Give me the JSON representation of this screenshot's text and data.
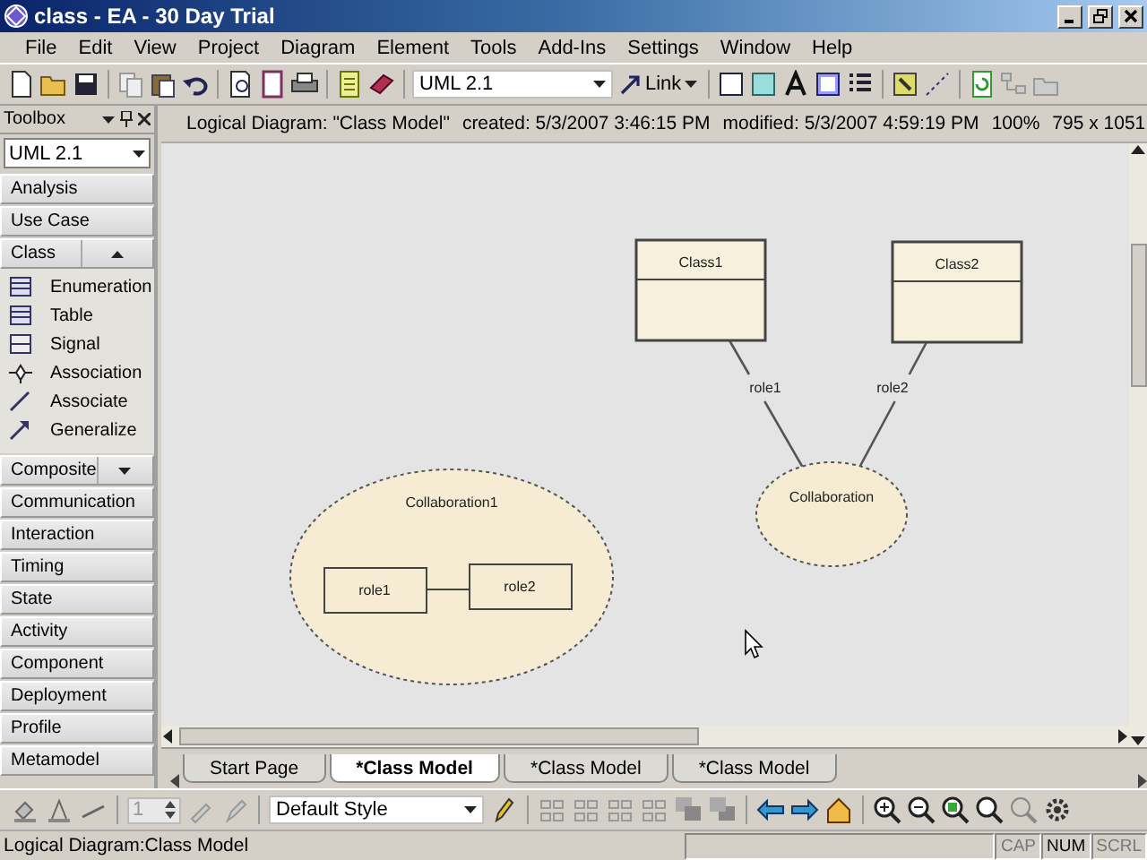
{
  "window": {
    "title": "class - EA - 30 Day Trial"
  },
  "menu": [
    "File",
    "Edit",
    "View",
    "Project",
    "Diagram",
    "Element",
    "Tools",
    "Add-Ins",
    "Settings",
    "Window",
    "Help"
  ],
  "toolbar": {
    "profile": "UML 2.1",
    "link": "Link"
  },
  "diagram_header": {
    "name": "Logical Diagram: \"Class Model\"",
    "created": "created: 5/3/2007 3:46:15 PM",
    "modified": "modified: 5/3/2007 4:59:19 PM",
    "zoom": "100%",
    "size": "795 x 1051"
  },
  "toolbox": {
    "title": "Toolbox",
    "profile": "UML 2.1",
    "groups": [
      {
        "label": "Analysis",
        "expanded": false
      },
      {
        "label": "Use Case",
        "expanded": false
      },
      {
        "label": "Class",
        "expanded": true,
        "items": [
          {
            "label": "Enumeration",
            "kind": "grid"
          },
          {
            "label": "Table",
            "kind": "grid"
          },
          {
            "label": "Signal",
            "kind": "signal"
          },
          {
            "label": "Association",
            "kind": "diamond"
          },
          {
            "label": "Associate",
            "kind": "line"
          },
          {
            "label": "Generalize",
            "kind": "arrow"
          }
        ]
      },
      {
        "label": "Composite",
        "expanded": false
      },
      {
        "label": "Communication",
        "expanded": false
      },
      {
        "label": "Interaction",
        "expanded": false
      },
      {
        "label": "Timing",
        "expanded": false
      },
      {
        "label": "State",
        "expanded": false
      },
      {
        "label": "Activity",
        "expanded": false
      },
      {
        "label": "Component",
        "expanded": false
      },
      {
        "label": "Deployment",
        "expanded": false
      },
      {
        "label": "Profile",
        "expanded": false
      },
      {
        "label": "Metamodel",
        "expanded": false
      }
    ]
  },
  "diagram": {
    "classes": [
      {
        "name": "Class1"
      },
      {
        "name": "Class2"
      }
    ],
    "links": [
      {
        "label": "role1"
      },
      {
        "label": "role2"
      }
    ],
    "collaboration": {
      "name": "Collaboration"
    },
    "composite": {
      "name": "Collaboration1",
      "parts": [
        "role1",
        "role2"
      ]
    }
  },
  "tabs": [
    {
      "label": "Start Page",
      "selected": false
    },
    {
      "label": "*Class Model",
      "selected": true
    },
    {
      "label": "*Class Model",
      "selected": false
    },
    {
      "label": "*Class Model",
      "selected": false
    }
  ],
  "bottom_toolbar": {
    "spinner": "1",
    "style": "Default Style"
  },
  "status_bar": {
    "text": "Logical Diagram:Class Model",
    "indicators": [
      {
        "label": "CAP",
        "on": false
      },
      {
        "label": "NUM",
        "on": true
      },
      {
        "label": "SCRL",
        "on": false
      }
    ]
  }
}
